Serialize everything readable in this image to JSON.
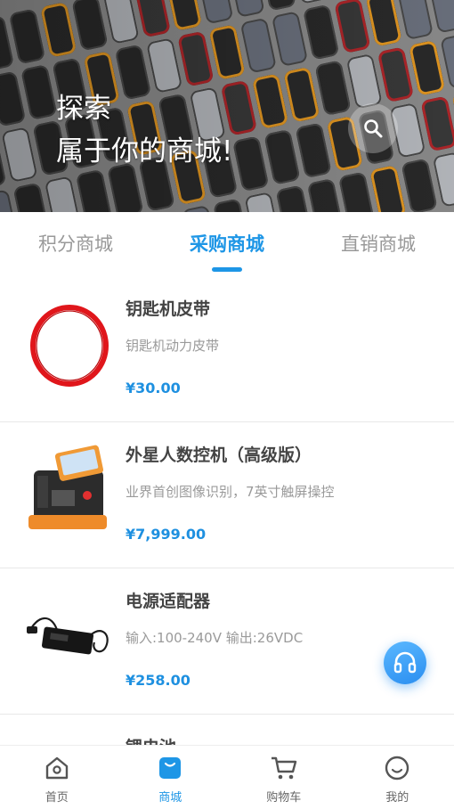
{
  "hero": {
    "line1": "探索",
    "line2": "属于你的商城!",
    "search_icon": "search-icon"
  },
  "tabs": [
    {
      "label": "积分商城",
      "active": false
    },
    {
      "label": "采购商城",
      "active": true
    },
    {
      "label": "直销商城",
      "active": false
    }
  ],
  "products": [
    {
      "name": "钥匙机皮带",
      "desc": "钥匙机动力皮带",
      "price": "¥30.00",
      "image": "red-belt-ring"
    },
    {
      "name": "外星人数控机（高级版）",
      "desc": "业界首创图像识别，7英寸触屏操控",
      "price": "¥7,999.00",
      "image": "key-cutting-machine"
    },
    {
      "name": "电源适配器",
      "desc": "输入:100-240V  输出:26VDC",
      "price": "¥258.00",
      "image": "power-adapter"
    },
    {
      "name": "锂电池",
      "desc": "",
      "price": "",
      "image": "battery"
    }
  ],
  "fab": {
    "icon": "headset-icon"
  },
  "bottom_nav": [
    {
      "label": "首页",
      "icon": "home-icon",
      "active": false
    },
    {
      "label": "商城",
      "icon": "shop-bag-icon",
      "active": true
    },
    {
      "label": "购物车",
      "icon": "cart-icon",
      "active": false
    },
    {
      "label": "我的",
      "icon": "smile-icon",
      "active": false
    }
  ],
  "colors": {
    "accent": "#1e96e6",
    "price": "#1e90e0",
    "inactive_text": "#999999"
  }
}
